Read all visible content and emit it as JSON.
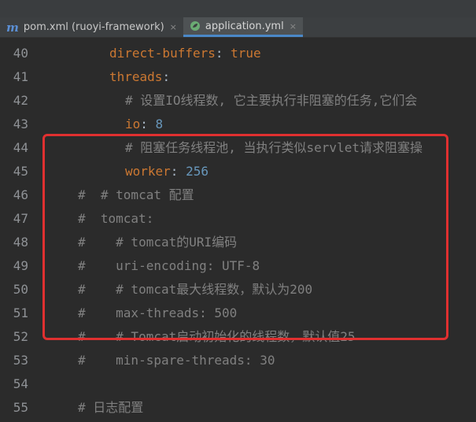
{
  "tabs": [
    {
      "icon": "maven-m-icon",
      "icon_glyph": "m",
      "label": "pom.xml (ruoyi-framework)",
      "close": "×",
      "active": false
    },
    {
      "icon": "spring-leaf-icon",
      "label": "application.yml",
      "close": "×",
      "active": true
    }
  ],
  "editor": {
    "lines": [
      {
        "num": "40",
        "parts": [
          {
            "t": "direct-buffers",
            "c": "key"
          },
          {
            "t": ": ",
            "c": "val"
          },
          {
            "t": "true",
            "c": "key"
          }
        ]
      },
      {
        "num": "41",
        "parts": [
          {
            "t": "threads",
            "c": "key"
          },
          {
            "t": ":",
            "c": "val"
          }
        ]
      },
      {
        "num": "42",
        "parts": [
          {
            "t": "# 设置IO线程数, 它主要执行非阻塞的任务,它们会",
            "c": "com"
          }
        ]
      },
      {
        "num": "43",
        "parts": [
          {
            "t": "io",
            "c": "key"
          },
          {
            "t": ": ",
            "c": "val"
          },
          {
            "t": "8",
            "c": "num"
          }
        ]
      },
      {
        "num": "44",
        "parts": [
          {
            "t": "# 阻塞任务线程池, 当执行类似servlet请求阻塞操",
            "c": "com"
          }
        ]
      },
      {
        "num": "45",
        "parts": [
          {
            "t": "worker",
            "c": "key"
          },
          {
            "t": ": ",
            "c": "val"
          },
          {
            "t": "256",
            "c": "num"
          }
        ]
      },
      {
        "num": "46",
        "parts": [
          {
            "t": "#  # tomcat 配置",
            "c": "com"
          }
        ]
      },
      {
        "num": "47",
        "parts": [
          {
            "t": "#  tomcat:",
            "c": "com"
          }
        ]
      },
      {
        "num": "48",
        "parts": [
          {
            "t": "#    # tomcat的URI编码",
            "c": "com"
          }
        ]
      },
      {
        "num": "49",
        "parts": [
          {
            "t": "#    uri-encoding: UTF-8",
            "c": "com"
          }
        ]
      },
      {
        "num": "50",
        "parts": [
          {
            "t": "#    # tomcat最大线程数，默认为200",
            "c": "com"
          }
        ]
      },
      {
        "num": "51",
        "parts": [
          {
            "t": "#    max-threads: 500",
            "c": "com"
          }
        ]
      },
      {
        "num": "52",
        "parts": [
          {
            "t": "#    # Tomcat启动初始化的线程数，默认值25",
            "c": "com"
          }
        ]
      },
      {
        "num": "53",
        "parts": [
          {
            "t": "#    min-spare-threads: 30",
            "c": "com"
          }
        ]
      },
      {
        "num": "54",
        "parts": []
      },
      {
        "num": "55",
        "parts": [
          {
            "t": "# 日志配置",
            "c": "com"
          }
        ]
      }
    ]
  },
  "colors": {
    "key": "#cc7832",
    "value": "#a9b7c6",
    "number": "#6897bb",
    "comment": "#808080",
    "highlight_border": "#e03030",
    "background": "#2b2b2b"
  }
}
